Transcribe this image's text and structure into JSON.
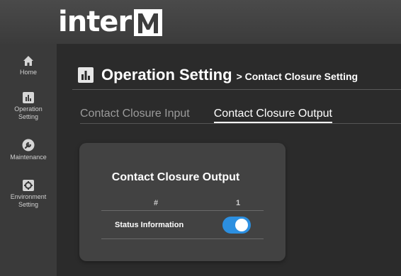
{
  "brand": {
    "logo_text": "inter",
    "logo_letter": "M"
  },
  "sidebar": {
    "items": [
      {
        "label": "Home",
        "icon": "home-icon"
      },
      {
        "label": "Operation\nSetting",
        "icon": "bar-chart-icon"
      },
      {
        "label": "Maintenance",
        "icon": "wrench-icon"
      },
      {
        "label": "Environment\nSetting",
        "icon": "gear-icon"
      }
    ]
  },
  "header": {
    "title": "Operation Setting",
    "breadcrumb": "> Contact Closure Setting"
  },
  "tabs": [
    {
      "label": "Contact Closure Input",
      "active": false
    },
    {
      "label": "Contact Closure Output",
      "active": true
    }
  ],
  "card": {
    "title": "Contact Closure Output",
    "col_hash": "#",
    "col_number": "1",
    "status_label": "Status Information",
    "status_on": true
  },
  "colors": {
    "toggle_on": "#2c8fe0",
    "background": "#2b2b2b",
    "sidebar": "#3a3a3a",
    "card": "#424242"
  }
}
